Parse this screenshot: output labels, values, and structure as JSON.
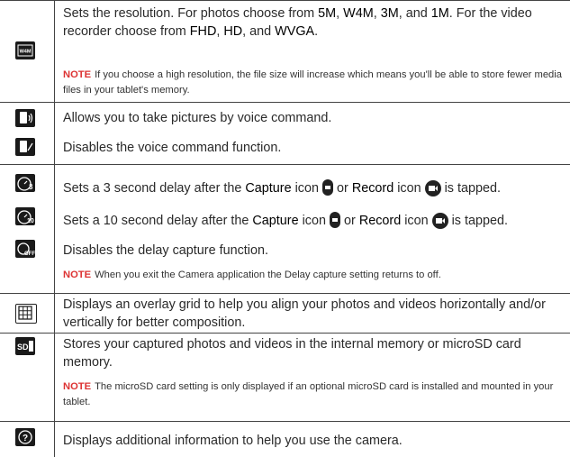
{
  "rows": [
    {
      "icon": "resolution-w4m-icon",
      "text_pre": "Sets the resolution. For photos choose from ",
      "opts_photo": [
        "5M",
        "W4M",
        "3M",
        "1M"
      ],
      "text_mid": ". For the video recorder choose from ",
      "opts_video": [
        "FHD",
        "HD",
        "WVGA"
      ],
      "note_label": "NOTE",
      "note_text": "If you choose a high resolution, the file size will increase which means you'll be able to store fewer media files in your tablet's memory."
    },
    {
      "icon": "voice-shutter-on-icon",
      "text": "Allows you to take pictures by voice command."
    },
    {
      "icon": "voice-shutter-off-icon",
      "text": "Disables the voice command function."
    },
    {
      "icon": "timer-3-icon",
      "text_a": "Sets a 3 second delay after the ",
      "capture": "Capture",
      "text_b": " icon ",
      "or": " or ",
      "record": "Record",
      "text_c": " icon ",
      "text_d": " is tapped."
    },
    {
      "icon": "timer-10-icon",
      "text_a": "Sets a 10 second delay after the ",
      "capture": "Capture",
      "text_b": " icon ",
      "or": " or ",
      "record": "Record",
      "text_c": " icon ",
      "text_d": " is tapped."
    },
    {
      "icon": "timer-off-icon",
      "text": "Disables the delay capture function.",
      "note_label": "NOTE",
      "note_text": "When you exit the Camera application the Delay capture setting returns to off."
    },
    {
      "icon": "grid-icon",
      "text": "Displays an overlay grid to help you align your photos and videos horizontally and/or vertically for better composition."
    },
    {
      "icon": "storage-sd-icon",
      "text": "Stores your captured photos and videos in the internal memory or microSD card memory.",
      "note_label": "NOTE",
      "note_text": "The microSD card setting is only displayed if an optional microSD card is installed and mounted in your tablet."
    },
    {
      "icon": "help-icon",
      "text": "Displays additional information to help you use the camera."
    }
  ]
}
